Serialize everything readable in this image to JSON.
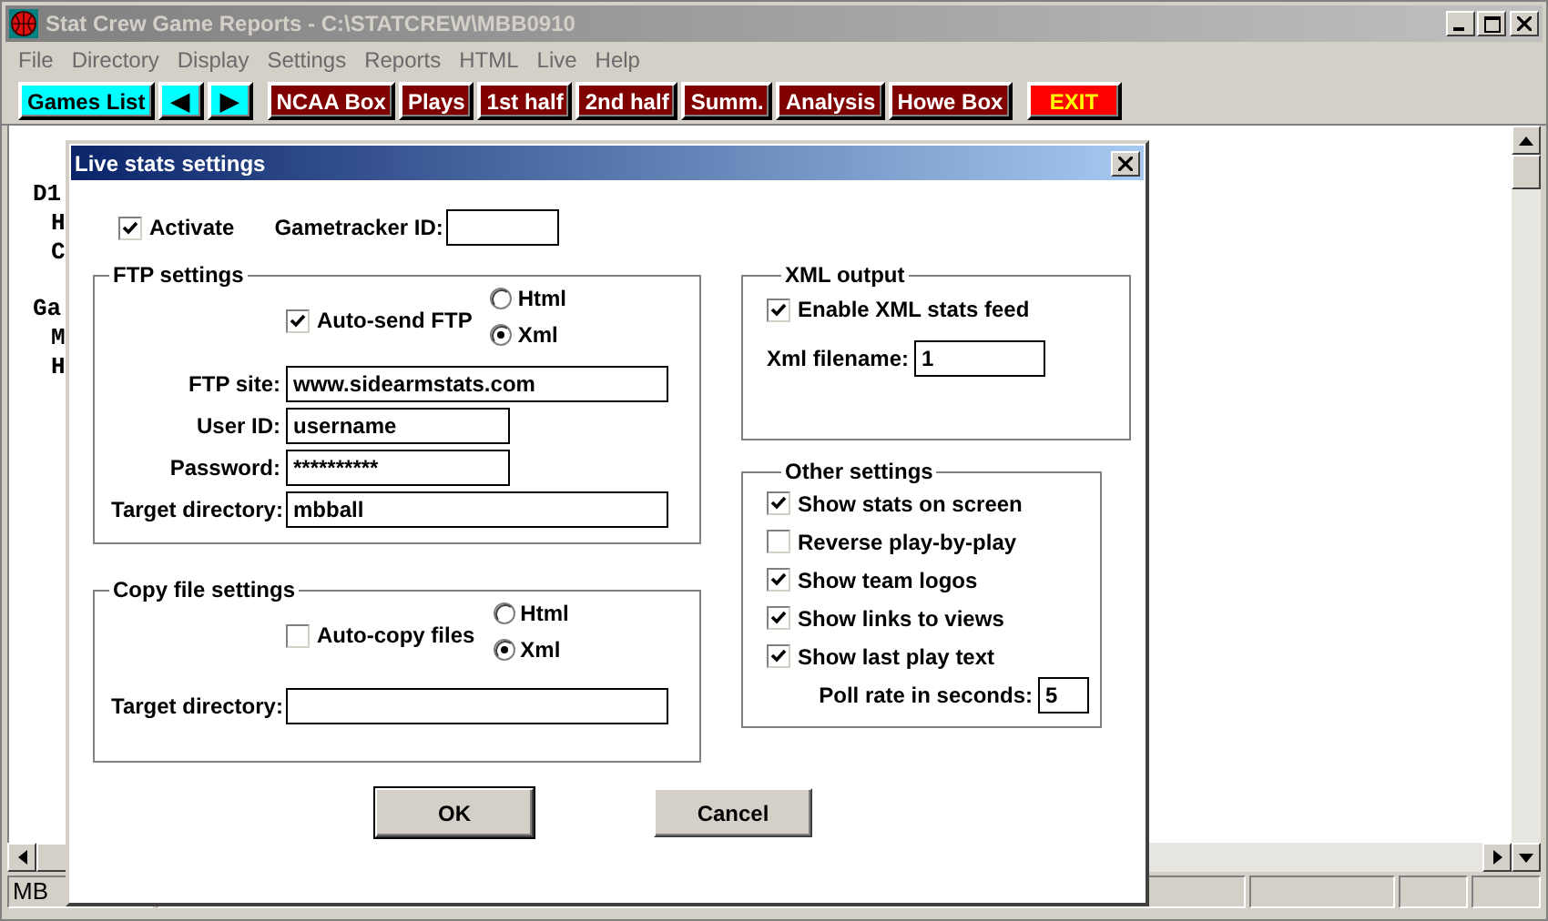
{
  "window": {
    "title": "Stat Crew Game Reports - C:\\STATCREW\\MBB0910"
  },
  "menu": [
    "File",
    "Directory",
    "Display",
    "Settings",
    "Reports",
    "HTML",
    "Live",
    "Help"
  ],
  "toolbar": [
    {
      "label": "Games List",
      "kind": "nav"
    },
    {
      "label": "◀",
      "kind": "nav"
    },
    {
      "label": "▶",
      "kind": "nav"
    },
    {
      "label": "NCAA Box",
      "kind": "report"
    },
    {
      "label": "Plays",
      "kind": "report"
    },
    {
      "label": "1st half",
      "kind": "report"
    },
    {
      "label": "2nd half",
      "kind": "report"
    },
    {
      "label": "Summ.",
      "kind": "report"
    },
    {
      "label": "Analysis",
      "kind": "report"
    },
    {
      "label": "Howe Box",
      "kind": "report"
    },
    {
      "label": "EXIT",
      "kind": "exit"
    }
  ],
  "content": [
    {
      "heading": "D1",
      "items": [
        "H",
        "C"
      ]
    },
    {
      "heading": "Ga",
      "items": [
        "M",
        "H"
      ]
    }
  ],
  "dialog": {
    "title": "Live stats settings",
    "activate": {
      "label": "Activate",
      "checked": true
    },
    "gametracker": {
      "label": "Gametracker ID:"
    },
    "ftp": {
      "title": "FTP settings",
      "auto": {
        "label": "Auto-send FTP",
        "checked": true
      },
      "formats": [
        {
          "label": "Html",
          "selected": false
        },
        {
          "label": "Xml",
          "selected": true
        }
      ],
      "fields": [
        {
          "label": "FTP site:",
          "value": "www.sidearmstats.com",
          "kind": "long"
        },
        {
          "label": "User ID:",
          "value": "username",
          "kind": "short"
        },
        {
          "label": "Password:",
          "value": "**********",
          "kind": "short"
        },
        {
          "label": "Target directory:",
          "value": "mbball",
          "kind": "long"
        }
      ]
    },
    "copy": {
      "title": "Copy file settings",
      "auto": {
        "label": "Auto-copy files",
        "checked": false
      },
      "formats": [
        {
          "label": "Html",
          "selected": false
        },
        {
          "label": "Xml",
          "selected": true
        }
      ],
      "fields": [
        {
          "label": "Target directory:",
          "kind": "long"
        }
      ]
    },
    "xml": {
      "title": "XML output",
      "enable": {
        "label": "Enable XML stats feed",
        "checked": true
      },
      "filename": {
        "label": "Xml filename:",
        "value": "1"
      }
    },
    "other": {
      "title": "Other settings",
      "options": [
        {
          "label": "Show stats on screen",
          "checked": true
        },
        {
          "label": "Reverse play-by-play",
          "checked": false
        },
        {
          "label": "Show team logos",
          "checked": true
        },
        {
          "label": "Show links to views",
          "checked": true
        },
        {
          "label": "Show last play text",
          "checked": true
        }
      ],
      "poll": {
        "label": "Poll rate in seconds:",
        "value": "5"
      }
    },
    "buttons": [
      {
        "label": "OK",
        "default": true
      },
      {
        "label": "Cancel",
        "default": false
      }
    ]
  },
  "status_bar": {
    "text": "MB"
  }
}
